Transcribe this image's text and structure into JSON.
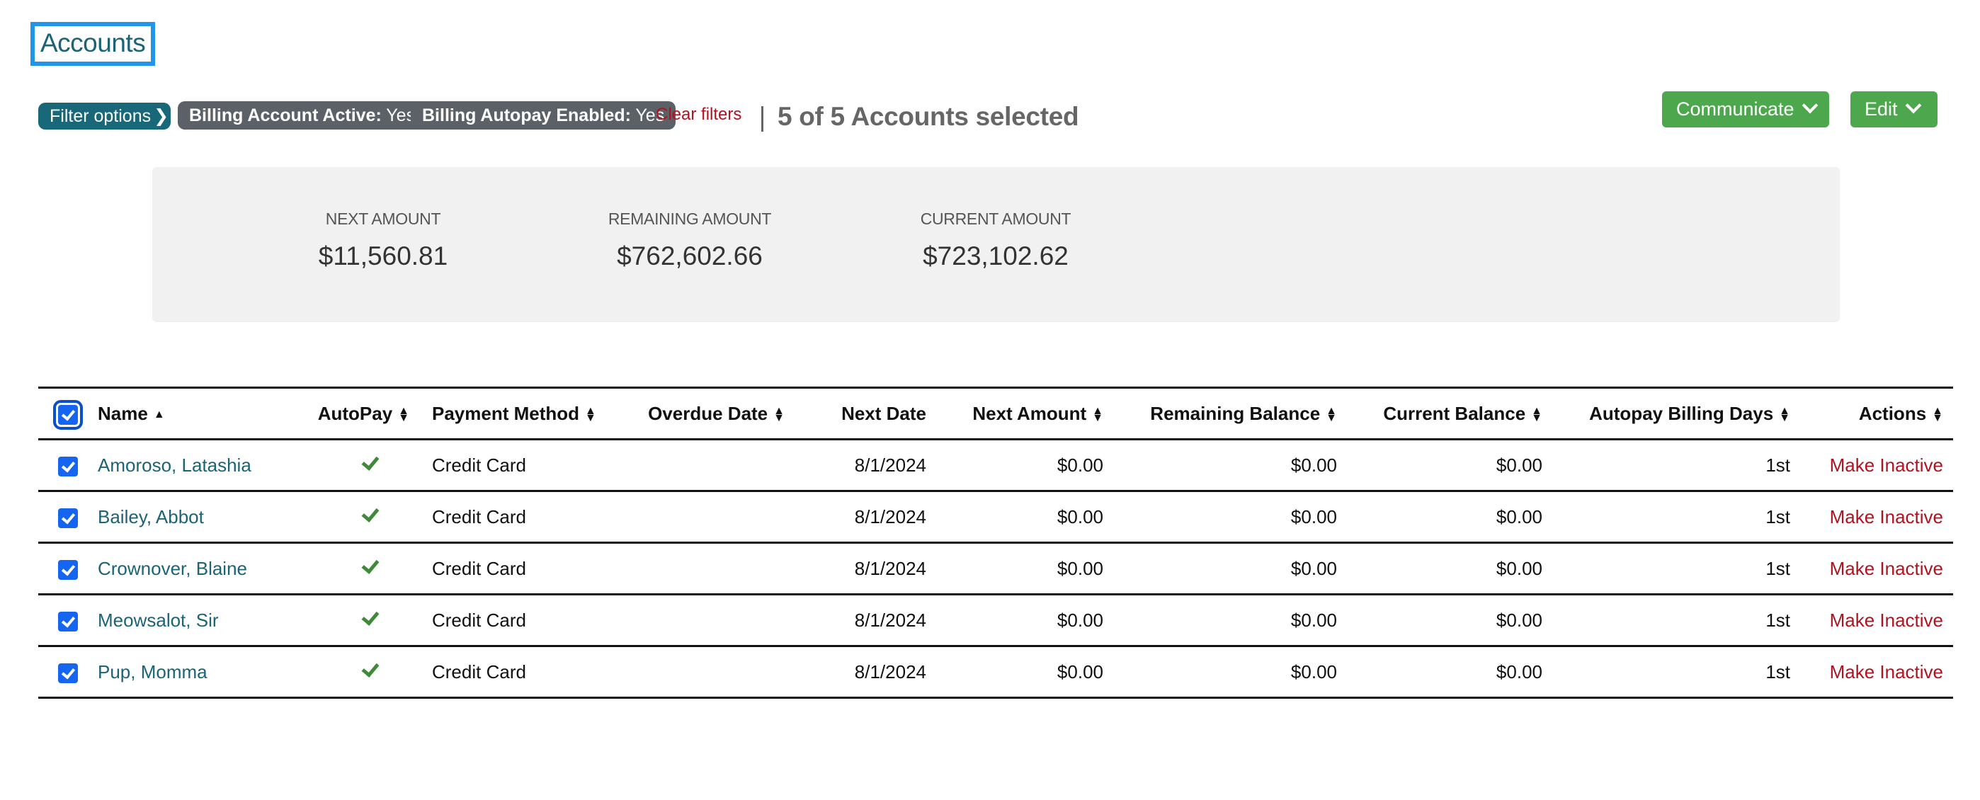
{
  "page": {
    "title": "Accounts"
  },
  "filters": {
    "filter_options_label": "Filter options",
    "tags": [
      {
        "key": "Billing Account Active:",
        "value": "Yes"
      },
      {
        "key": "Billing Autopay Enabled:",
        "value": "Yes"
      }
    ],
    "clear_label": "Clear filters",
    "selection_summary": "5 of 5 Accounts selected"
  },
  "toolbar": {
    "communicate_label": "Communicate",
    "edit_label": "Edit"
  },
  "summary": {
    "stats": [
      {
        "label": "NEXT AMOUNT",
        "value": "$11,560.81"
      },
      {
        "label": "REMAINING AMOUNT",
        "value": "$762,602.66"
      },
      {
        "label": "CURRENT AMOUNT",
        "value": "$723,102.62"
      }
    ]
  },
  "table": {
    "columns": [
      {
        "key": "select",
        "label": ""
      },
      {
        "key": "name",
        "label": "Name",
        "sort": "asc"
      },
      {
        "key": "autopay",
        "label": "AutoPay",
        "sort": "both"
      },
      {
        "key": "payment_method",
        "label": "Payment Method",
        "sort": "both"
      },
      {
        "key": "overdue_date",
        "label": "Overdue Date",
        "sort": "both"
      },
      {
        "key": "next_date",
        "label": "Next Date",
        "sort": "none"
      },
      {
        "key": "next_amount",
        "label": "Next Amount",
        "sort": "both"
      },
      {
        "key": "remaining_balance",
        "label": "Remaining Balance",
        "sort": "both"
      },
      {
        "key": "current_balance",
        "label": "Current Balance",
        "sort": "both"
      },
      {
        "key": "autopay_billing_days",
        "label": "Autopay Billing Days",
        "sort": "both"
      },
      {
        "key": "actions",
        "label": "Actions",
        "sort": "both"
      }
    ],
    "header_checked": true,
    "rows": [
      {
        "checked": true,
        "name": "Amoroso, Latashia",
        "autopay": true,
        "payment_method": "Credit Card",
        "overdue_date": "",
        "next_date": "8/1/2024",
        "next_amount": "$0.00",
        "remaining_balance": "$0.00",
        "current_balance": "$0.00",
        "autopay_billing_days": "1st",
        "action": "Make Inactive"
      },
      {
        "checked": true,
        "name": "Bailey, Abbot",
        "autopay": true,
        "payment_method": "Credit Card",
        "overdue_date": "",
        "next_date": "8/1/2024",
        "next_amount": "$0.00",
        "remaining_balance": "$0.00",
        "current_balance": "$0.00",
        "autopay_billing_days": "1st",
        "action": "Make Inactive"
      },
      {
        "checked": true,
        "name": "Crownover, Blaine",
        "autopay": true,
        "payment_method": "Credit Card",
        "overdue_date": "",
        "next_date": "8/1/2024",
        "next_amount": "$0.00",
        "remaining_balance": "$0.00",
        "current_balance": "$0.00",
        "autopay_billing_days": "1st",
        "action": "Make Inactive"
      },
      {
        "checked": true,
        "name": "Meowsalot, Sir",
        "autopay": true,
        "payment_method": "Credit Card",
        "overdue_date": "",
        "next_date": "8/1/2024",
        "next_amount": "$0.00",
        "remaining_balance": "$0.00",
        "current_balance": "$0.00",
        "autopay_billing_days": "1st",
        "action": "Make Inactive"
      },
      {
        "checked": true,
        "name": "Pup, Momma",
        "autopay": true,
        "payment_method": "Credit Card",
        "overdue_date": "",
        "next_date": "8/1/2024",
        "next_amount": "$0.00",
        "remaining_balance": "$0.00",
        "current_balance": "$0.00",
        "autopay_billing_days": "1st",
        "action": "Make Inactive"
      }
    ]
  },
  "colors": {
    "title_focus_ring": "#2196e8",
    "link_teal": "#1b6475",
    "filter_pill": "#18687a",
    "tag_pill": "#5c6168",
    "danger_red": "#b0131f",
    "button_green": "#4da84d",
    "checkbox_blue": "#1665f0",
    "check_green": "#3e8a39",
    "panel_bg": "#f1f1f1"
  }
}
